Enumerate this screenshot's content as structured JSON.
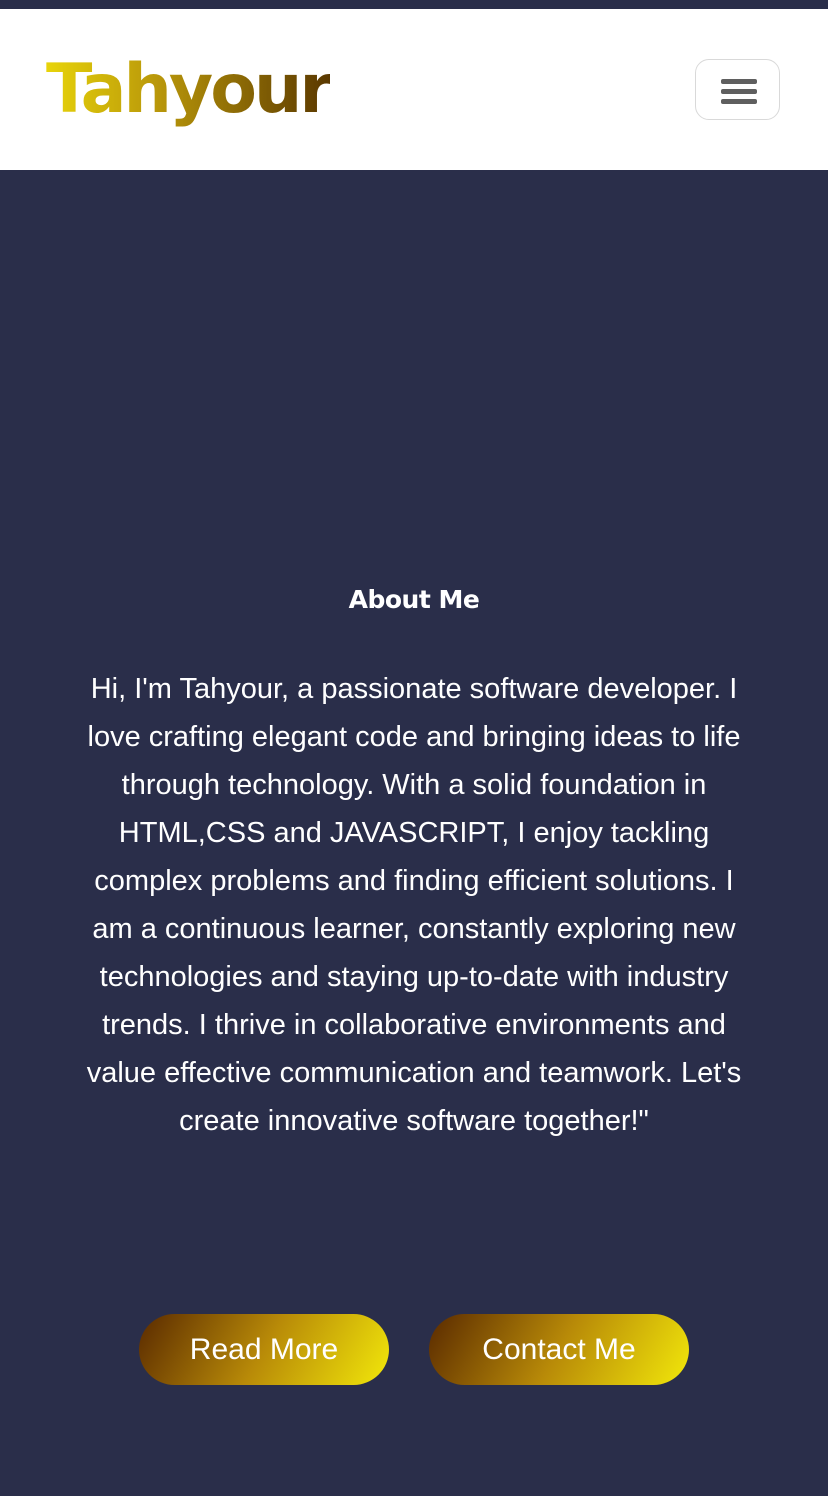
{
  "header": {
    "logo_text": "Tahyour",
    "menu_icon": "hamburger-menu-icon"
  },
  "about": {
    "heading": "About Me",
    "body": "Hi, I'm Tahyour, a passionate software developer. I love crafting elegant code and bringing ideas to life through technology. With a solid foundation in HTML,CSS and JAVASCRIPT, I enjoy tackling complex problems and finding efficient solutions. I am a continuous learner, constantly exploring new technologies and staying up-to-date with industry trends. I thrive in collaborative environments and value effective communication and teamwork. Let's create innovative software together!\""
  },
  "buttons": {
    "read_more": "Read More",
    "contact_me": "Contact Me"
  },
  "colors": {
    "background": "#2a2e4a",
    "navbar": "#ffffff",
    "logo_gradient_start": "#e8d40a",
    "logo_gradient_end": "#5a3800",
    "button_gradient_start": "#5a2a00",
    "button_gradient_end": "#f2e80a"
  }
}
